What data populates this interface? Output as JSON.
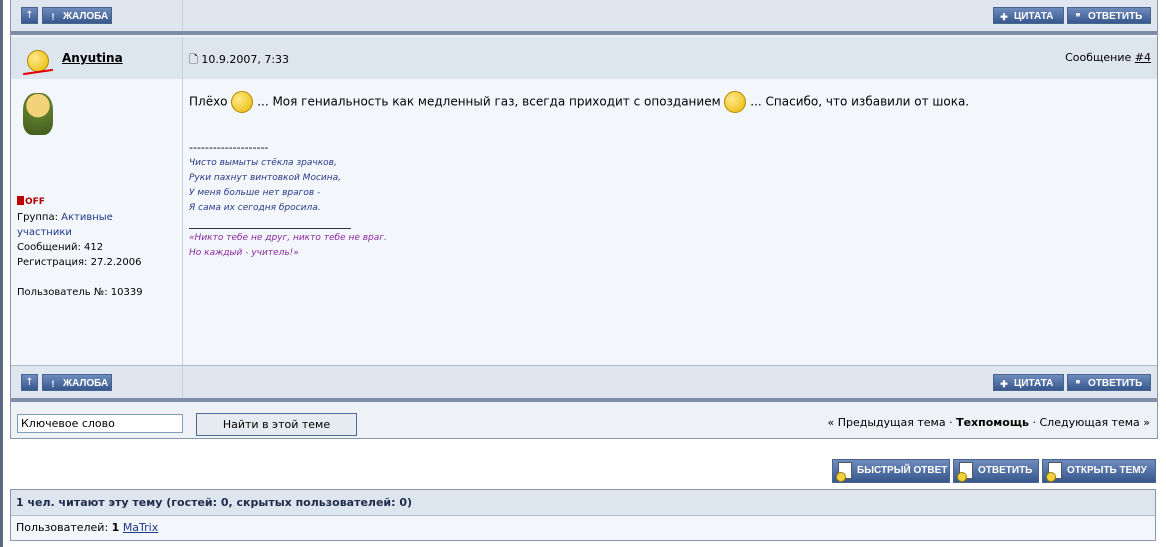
{
  "buttons": {
    "up_icon": "up-arrow-icon",
    "report": "ЖАЛОБА",
    "quote": "ЦИТАТА",
    "reply": "ОТВЕТИТЬ"
  },
  "post": {
    "author": "Anyutina",
    "date": "10.9.2007, 7:33",
    "number_label": "Сообщение",
    "number_link": "#4",
    "text_parts": [
      "Плёхо",
      "... Моя гениальность как медленный газ, всегда приходит с опозданием",
      "... Спасибо, что избавили от шока."
    ],
    "signature": {
      "divider": "--------------------",
      "lines": [
        "Чисто вымыты стёкла зрачков,",
        "Руки пахнут винтовкой Мосина,",
        "У меня больше нет врагов -",
        "Я сама их сегодня бросила."
      ],
      "quote_lines": [
        "«Никто тебе не друг, никто тебе не враг.",
        "Но каждый - учитель!»"
      ]
    },
    "user_info": {
      "status": "OFF",
      "group_label": "Группа:",
      "group_value_1": "Активные",
      "group_value_2": "участники",
      "posts": "Сообщений: 412",
      "registered": "Регистрация: 27.2.2006",
      "user_no": "Пользователь №: 10339"
    }
  },
  "search": {
    "placeholder": "Ключевое слово",
    "button": "Найти в этой теме"
  },
  "nav": {
    "prev": "« Предыдущая тема",
    "dot1": "·",
    "current": "Техпомощь",
    "dot2": "·",
    "next": "Следующая тема »"
  },
  "actions": {
    "fast_reply": "БЫСТРЫЙ ОТВЕТ",
    "reply": "ОТВЕТИТЬ",
    "new_topic": "ОТКРЫТЬ ТЕМУ"
  },
  "readers": {
    "header": "1 чел. читают эту тему (гостей: 0, скрытых пользователей: 0)",
    "users_label": "Пользователей:",
    "users_count": "1",
    "user": "MaTrix"
  },
  "colors": {
    "accent": "#37578d",
    "header_bg": "#dde5ef",
    "body_bg": "#f3f6fa"
  }
}
